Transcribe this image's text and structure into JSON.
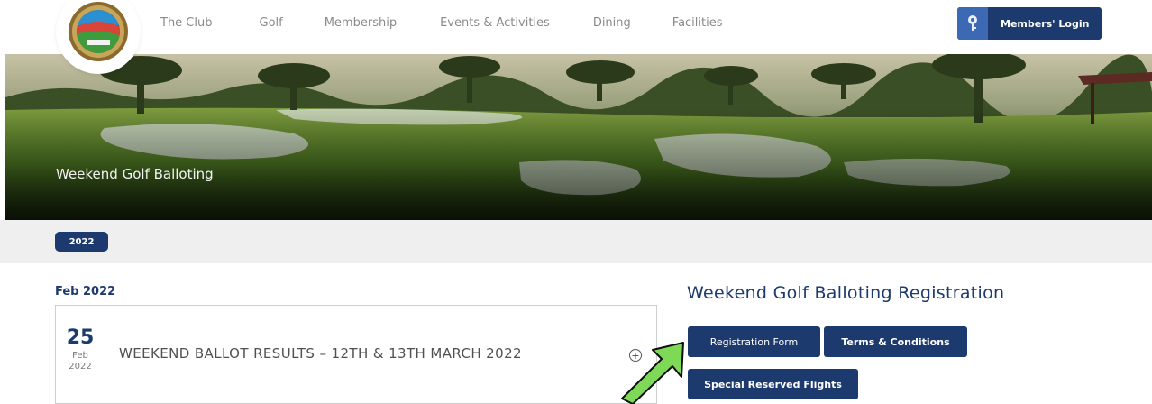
{
  "nav": {
    "items": [
      "The Club",
      "Golf",
      "Membership",
      "Events & Activities",
      "Dining",
      "Facilities"
    ],
    "login_label": "Members' Login",
    "login_icon": "key-icon"
  },
  "hero": {
    "title": "Weekend Golf Balloting"
  },
  "year_filter": {
    "selected": "2022"
  },
  "listing": {
    "month_heading": "Feb 2022",
    "posts": [
      {
        "day": "25",
        "month": "Feb",
        "year": "2022",
        "title": "WEEKEND BALLOT RESULTS – 12TH & 13TH MARCH 2022",
        "icon": "plus-circle-icon"
      }
    ]
  },
  "registration": {
    "heading": "Weekend Golf Balloting Registration",
    "buttons": {
      "form": "Registration Form",
      "terms": "Terms & Conditions",
      "special": "Special Reserved Flights"
    }
  },
  "colors": {
    "navy": "#1d3a6e",
    "key_blue": "#3d68b4",
    "arrow_green": "#7ed957",
    "year_bar": "#efefef"
  }
}
